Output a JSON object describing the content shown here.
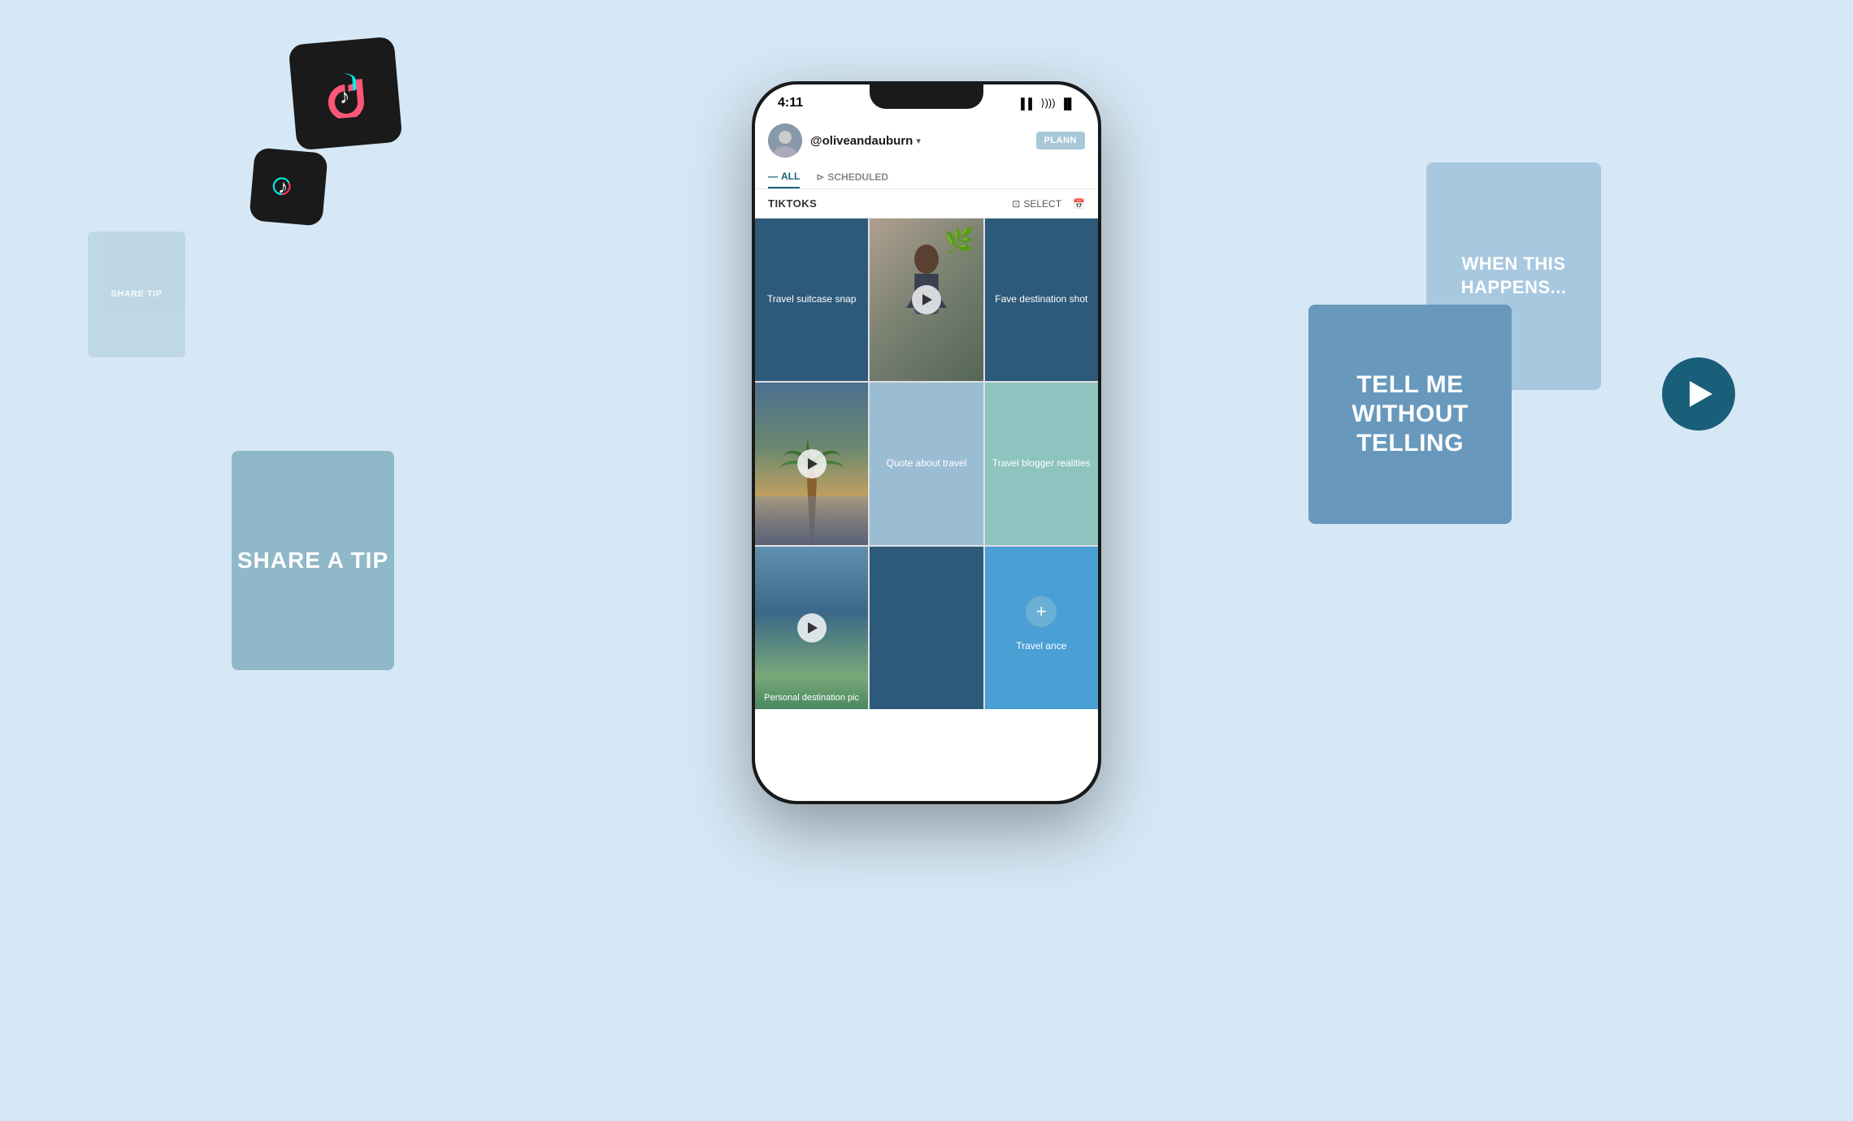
{
  "background_color": "#d6e8f5",
  "tiktok_icons": [
    {
      "id": "large",
      "emoji": "♪"
    },
    {
      "id": "small",
      "emoji": "♪"
    }
  ],
  "floating_cards": {
    "share_tip_small": {
      "text": "SHARE TIP"
    },
    "share_tip_large": {
      "text": "SHARE A TIP"
    },
    "when_this": {
      "text": "WHEN THIS HAPPENS..."
    },
    "tell_me": {
      "text": "TELL ME WITHOUT TELLING"
    }
  },
  "phone": {
    "status_bar": {
      "time": "4:11",
      "icons": "▌▌ ))) ▐"
    },
    "header": {
      "username": "@oliveandauburn",
      "tabs": [
        {
          "label": "ALL",
          "active": true
        },
        {
          "label": "SCHEDULED",
          "active": false
        }
      ],
      "plann_label": "PLANN"
    },
    "toolbar": {
      "title": "TIKTOKS",
      "select_label": "SELECT"
    },
    "grid": [
      {
        "id": "travel-suitcase",
        "type": "text",
        "label": "Travel suitcase snap",
        "bg": "dark-blue"
      },
      {
        "id": "woman-plant",
        "type": "photo",
        "label": "",
        "has_play": true,
        "bg": "photo"
      },
      {
        "id": "fave-destination",
        "type": "text",
        "label": "Fave destination shot",
        "bg": "dark-blue"
      },
      {
        "id": "palm-tree",
        "type": "photo",
        "label": "",
        "has_play": true,
        "bg": "photo"
      },
      {
        "id": "quote-travel",
        "type": "text",
        "label": "Quote about travel",
        "bg": "light-blue"
      },
      {
        "id": "travel-blogger",
        "type": "text",
        "label": "Travel blogger realities",
        "bg": "teal"
      },
      {
        "id": "bottom-left",
        "type": "photo",
        "label": "Personal destination pic",
        "has_play": true,
        "bg": "photo"
      },
      {
        "id": "bottom-mid",
        "type": "text",
        "label": "",
        "bg": "dark-blue"
      },
      {
        "id": "bottom-right",
        "type": "add",
        "label": "Travel ance",
        "bg": "blue"
      }
    ]
  }
}
